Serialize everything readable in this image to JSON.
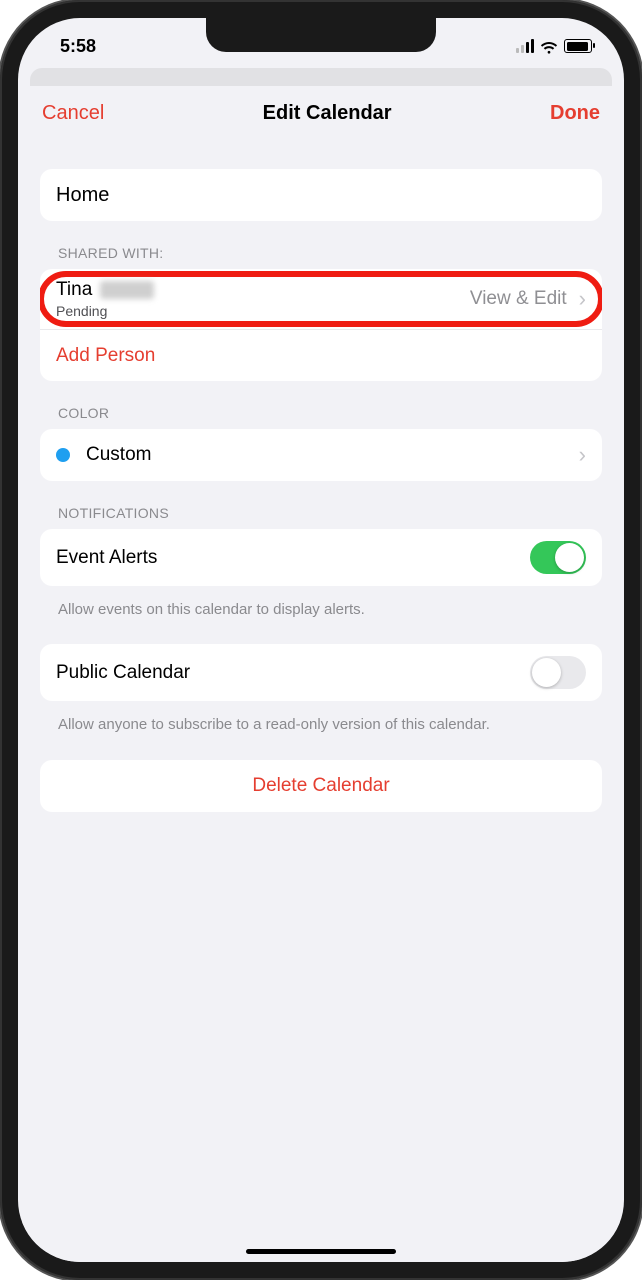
{
  "statusbar": {
    "time": "5:58"
  },
  "nav": {
    "cancel": "Cancel",
    "title": "Edit Calendar",
    "done": "Done"
  },
  "calendar": {
    "name": "Home"
  },
  "shared": {
    "header": "SHARED WITH:",
    "person": {
      "name": "Tina",
      "status": "Pending",
      "permission": "View & Edit"
    },
    "add_label": "Add Person"
  },
  "color": {
    "header": "COLOR",
    "value": "Custom",
    "hex": "#1f9ff0"
  },
  "notifications": {
    "header": "NOTIFICATIONS",
    "event_alerts_label": "Event Alerts",
    "event_alerts_on": true,
    "event_alerts_footer": "Allow events on this calendar to display alerts."
  },
  "public": {
    "label": "Public Calendar",
    "on": false,
    "footer": "Allow anyone to subscribe to a read-only version of this calendar."
  },
  "delete_label": "Delete Calendar"
}
